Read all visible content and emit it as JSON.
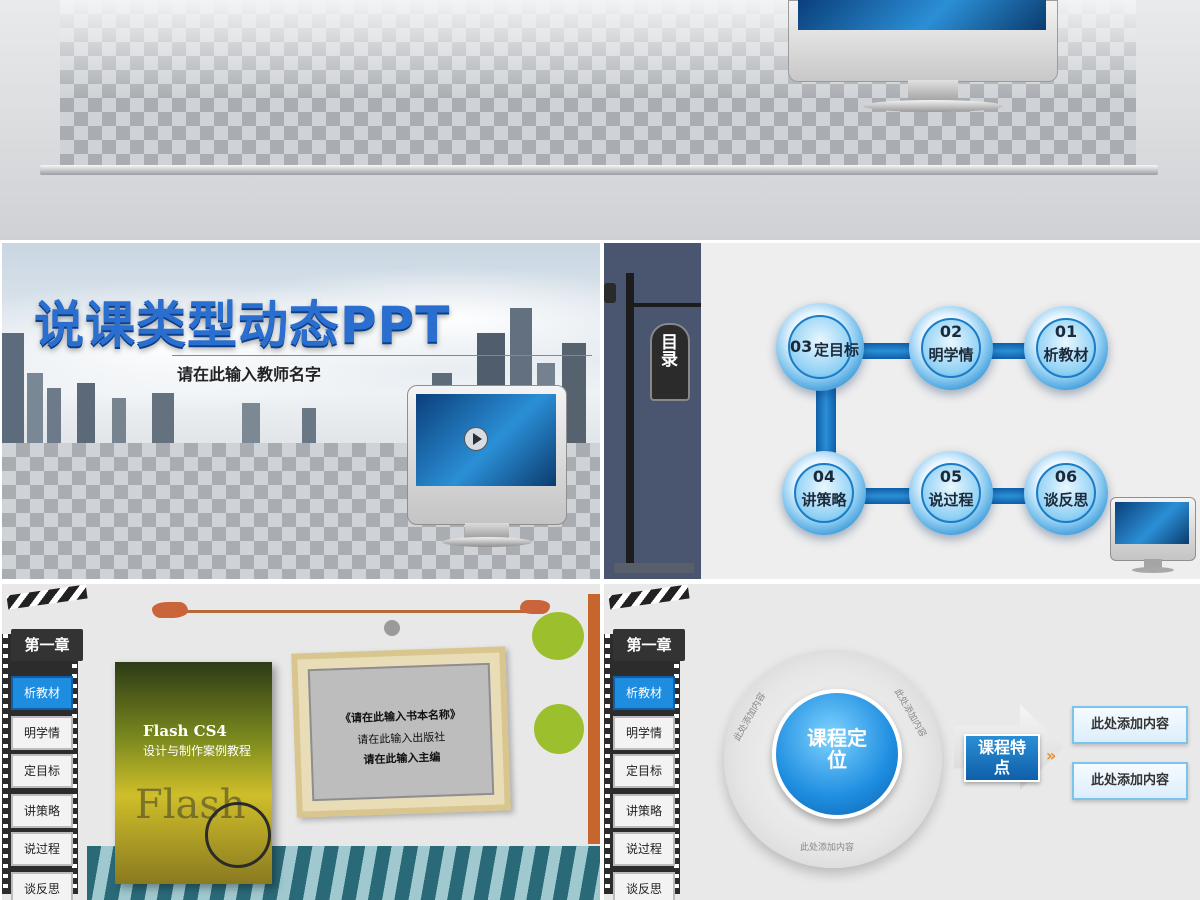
{
  "slide_cover": {
    "title": "说课类型动态PPT",
    "subtitle": "请在此输入教师名字"
  },
  "slide_toc": {
    "sign_label": "目录",
    "items": [
      {
        "num": "01",
        "label": "析教材"
      },
      {
        "num": "02",
        "label": "明学情"
      },
      {
        "num": "03",
        "label": "定目标"
      },
      {
        "num": "04",
        "label": "讲策略"
      },
      {
        "num": "05",
        "label": "说过程"
      },
      {
        "num": "06",
        "label": "谈反思"
      }
    ]
  },
  "sidebar": {
    "chapter": "第一章",
    "items": [
      "析教材",
      "明学情",
      "定目标",
      "讲策略",
      "说过程",
      "谈反思"
    ]
  },
  "slide_book": {
    "book_title": "Flash CS4",
    "book_subtitle": "设计与制作案例教程",
    "book_cover_text": "Flash",
    "frame_line1": "《请在此输入书本名称》",
    "frame_line2": "请在此输入出版社",
    "frame_line3": "请在此输入主编"
  },
  "slide_course": {
    "center_label": "课程定位",
    "ring_text": "此处添加内容",
    "feature_label": "课程特点",
    "boxes": [
      "此处添加内容",
      "此处添加内容"
    ]
  },
  "colors": {
    "accent_blue": "#1e8de0",
    "dark_panel": "#4a5670",
    "title_blue": "#2a6fd0"
  }
}
